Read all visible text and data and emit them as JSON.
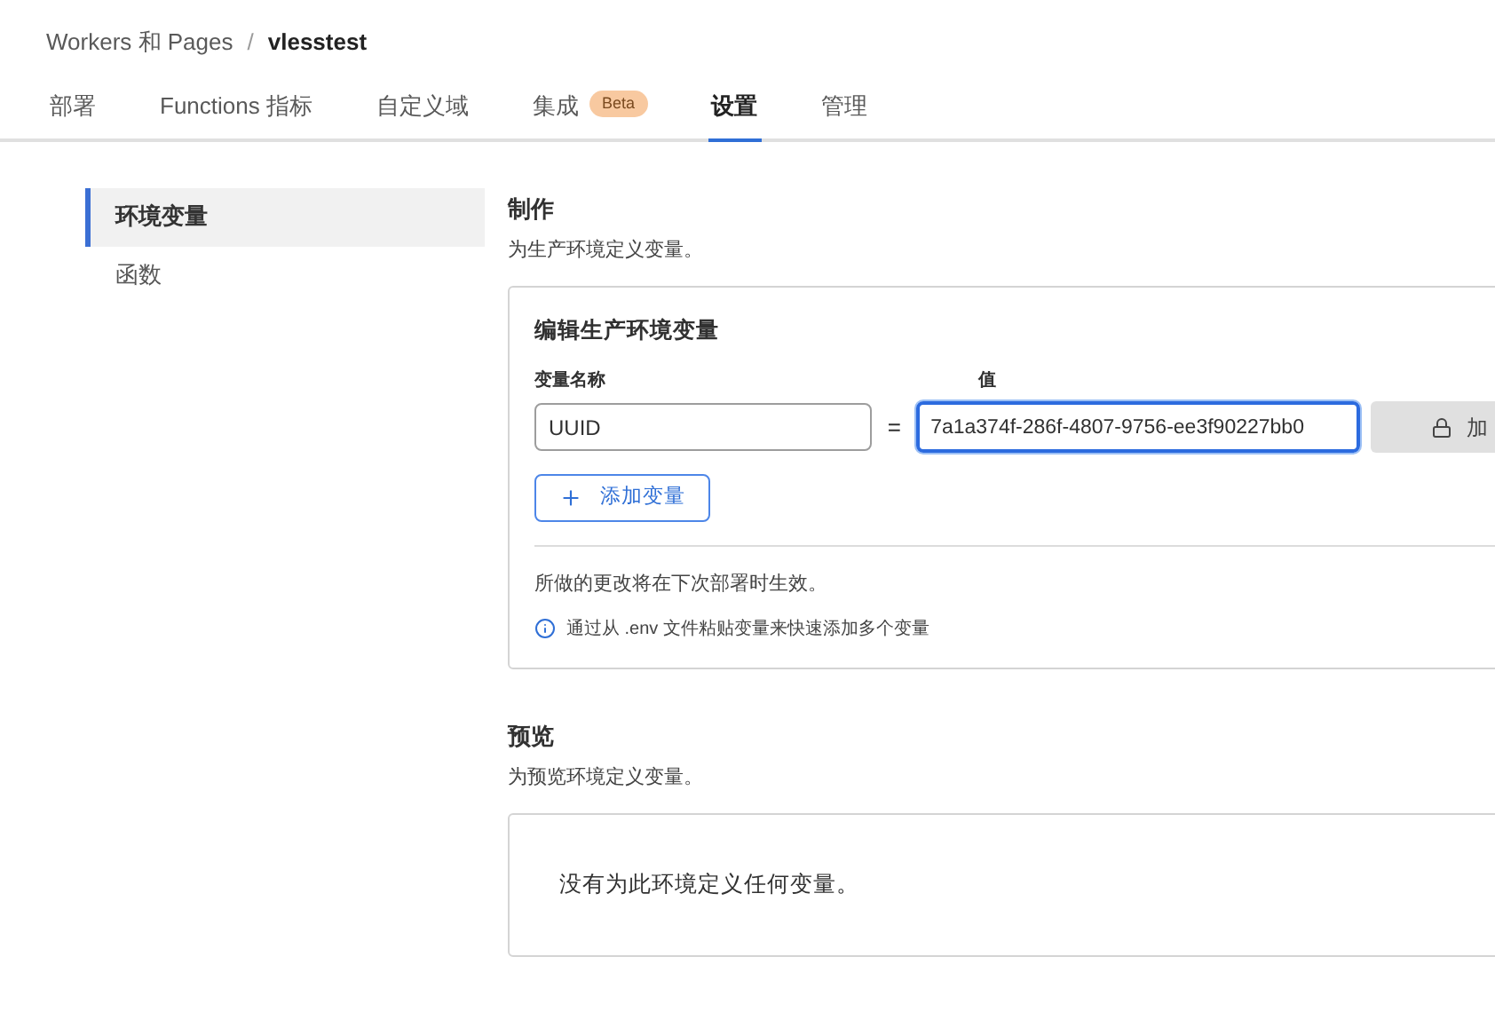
{
  "breadcrumb": {
    "parent": "Workers 和 Pages",
    "separator": "/",
    "current": "vlesstest"
  },
  "tabs": [
    {
      "label": "部署",
      "selected": false
    },
    {
      "label": "Functions 指标",
      "selected": false
    },
    {
      "label": "自定义域",
      "selected": false
    },
    {
      "label": "集成",
      "badge": "Beta",
      "selected": false
    },
    {
      "label": "设置",
      "selected": true
    },
    {
      "label": "管理",
      "selected": false
    }
  ],
  "sidebar": {
    "items": [
      {
        "label": "环境变量",
        "selected": true
      },
      {
        "label": "函数",
        "selected": false
      }
    ]
  },
  "production": {
    "title": "制作",
    "description": "为生产环境定义变量。",
    "card_title": "编辑生产环境变量",
    "name_label": "变量名称",
    "value_label": "值",
    "variables": [
      {
        "name": "UUID",
        "equals": "=",
        "value": "7a1a374f-286f-4807-9756-ee3f90227bb0",
        "encrypt_button": "加"
      }
    ],
    "add_button": "添加变量",
    "note": "所做的更改将在下次部署时生效。",
    "hint": "通过从 .env 文件粘贴变量来快速添加多个变量"
  },
  "preview": {
    "title": "预览",
    "description": "为预览环境定义变量。",
    "empty_message": "没有为此环境定义任何变量。"
  }
}
